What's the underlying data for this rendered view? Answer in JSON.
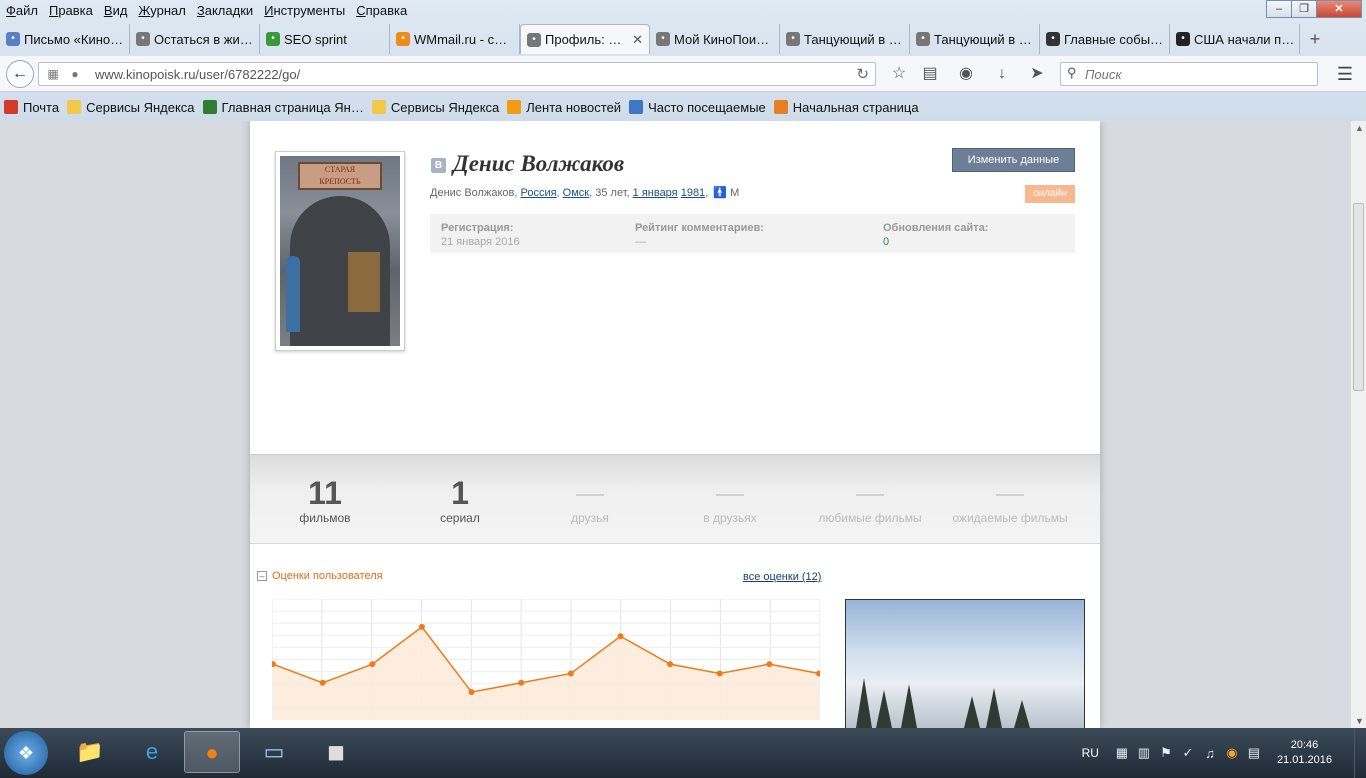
{
  "menubar": [
    "Файл",
    "Правка",
    "Вид",
    "Журнал",
    "Закладки",
    "Инструменты",
    "Справка"
  ],
  "tabs": [
    {
      "label": "Письмо «Кино…",
      "icon": "mail-icon",
      "color": "#5b7fc4"
    },
    {
      "label": "Остаться в жи…",
      "icon": "film-reel-icon",
      "color": "#777777"
    },
    {
      "label": "SEO sprint",
      "icon": "seo-sprint-icon",
      "color": "#3a9a3a"
    },
    {
      "label": "WMmail.ru - с…",
      "icon": "wmmail-icon",
      "color": "#f08a1a"
    },
    {
      "label": "Профиль: …",
      "icon": "film-reel-icon",
      "color": "#777777",
      "active": true
    },
    {
      "label": "Мой КиноПои…",
      "icon": "film-reel-icon",
      "color": "#777777"
    },
    {
      "label": "Танцующий в …",
      "icon": "film-reel-icon",
      "color": "#777777"
    },
    {
      "label": "Танцующий в …",
      "icon": "film-reel-icon",
      "color": "#777777"
    },
    {
      "label": "Главные собы…",
      "icon": "news-icon",
      "color": "#333333"
    },
    {
      "label": "США начали п…",
      "icon": "check-icon",
      "color": "#222222"
    }
  ],
  "address_bar": {
    "url": "www.kinopoisk.ru/user/6782222/go/"
  },
  "search_bar": {
    "placeholder": "Поиск"
  },
  "bookmarks": [
    {
      "label": "Почта",
      "color": "#d23a2a"
    },
    {
      "label": "Сервисы Яндекса",
      "color": "#f1c94a"
    },
    {
      "label": "Главная страница Ян…",
      "color": "#2e7d32"
    },
    {
      "label": "Сервисы Яндекса",
      "color": "#f1c94a"
    },
    {
      "label": "Лента новостей",
      "color": "#f39c12"
    },
    {
      "label": "Часто посещаемые",
      "color": "#3c78c4"
    },
    {
      "label": "Начальная страница",
      "color": "#e67e22"
    }
  ],
  "profile": {
    "vk_badge": "В",
    "name": "Денис Волжаков",
    "edit_button": "Изменить данные",
    "online": "онлайн",
    "info_name": "Денис Волжаков,",
    "country": "Россия",
    "city": "Омск",
    "age": "35 лет,",
    "birth_date": "1 января",
    "birth_year": "1981",
    "gender": "М",
    "stats": {
      "registration_label": "Регистрация:",
      "registration_value": "21 января 2016",
      "comments_label": "Рейтинг комментариев:",
      "comments_value": "—",
      "updates_label": "Обновления сайта:",
      "updates_value": "0"
    }
  },
  "counts": [
    {
      "value": "11",
      "label": "фильмов",
      "dim": false
    },
    {
      "value": "1",
      "label": "сериал",
      "dim": false
    },
    {
      "value": "—",
      "label": "друзья",
      "dim": true
    },
    {
      "value": "—",
      "label": "в друзьях",
      "dim": true
    },
    {
      "value": "—",
      "label": "любимые фильмы",
      "dim": true
    },
    {
      "value": "—",
      "label": "ожидаемые фильмы",
      "dim": true
    }
  ],
  "ratings": {
    "title": "Оценки пользователя",
    "all_link": "все оценки (12)"
  },
  "chart_data": {
    "type": "area",
    "values": [
      6,
      4,
      6,
      10,
      3,
      4,
      5,
      9,
      6,
      5,
      6,
      5
    ],
    "ylim": [
      0,
      13
    ],
    "grid": true,
    "line_color": "#f07a1a",
    "fill_color": "#fdebdc"
  },
  "taskbar": {
    "apps": [
      "explorer-icon",
      "ie-icon",
      "firefox-icon",
      "notepad-icon",
      "world-of-tanks-icon"
    ],
    "lang": "RU",
    "time": "20:46",
    "date": "21.01.2016"
  }
}
